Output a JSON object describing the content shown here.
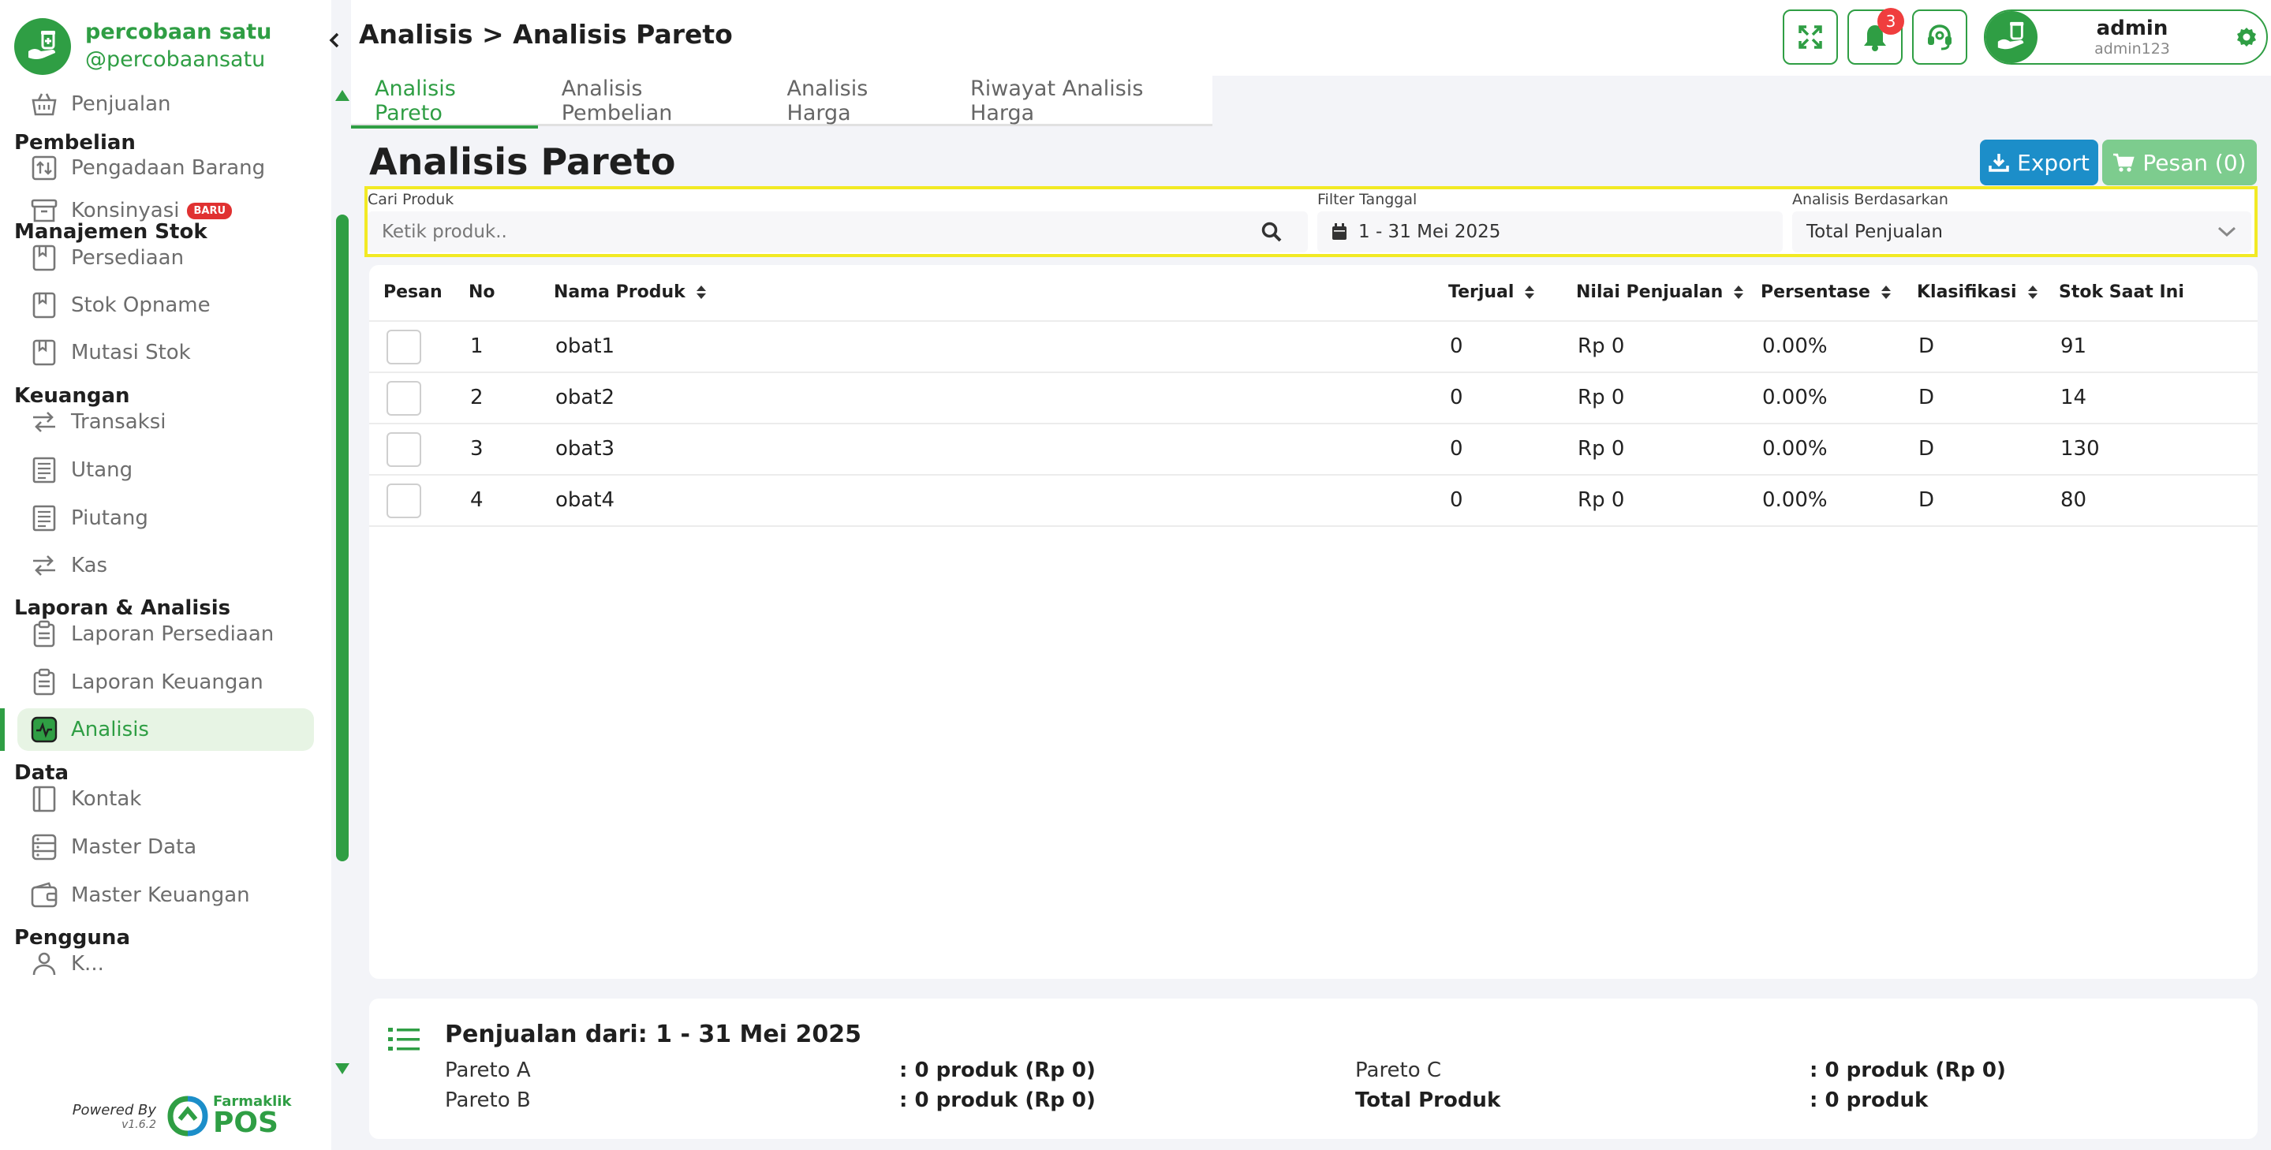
{
  "brand": {
    "name": "percobaan satu",
    "handle": "@percobaansatu"
  },
  "sidebar": {
    "items": [
      {
        "type": "item",
        "label": "Penjualan",
        "icon": "basket-icon"
      },
      {
        "type": "header",
        "label": "Pembelian"
      },
      {
        "type": "item",
        "label": "Pengadaan Barang",
        "icon": "box-transfer-icon"
      },
      {
        "type": "item",
        "label": "Konsinyasi",
        "icon": "archive-icon",
        "badge": "BARU"
      },
      {
        "type": "header",
        "label": "Manajemen Stok"
      },
      {
        "type": "item",
        "label": "Persediaan",
        "icon": "bookmark-icon"
      },
      {
        "type": "item",
        "label": "Stok Opname",
        "icon": "bookmark-icon"
      },
      {
        "type": "item",
        "label": "Mutasi Stok",
        "icon": "bookmark-icon"
      },
      {
        "type": "header",
        "label": "Keuangan"
      },
      {
        "type": "item",
        "label": "Transaksi",
        "icon": "transfer-icon"
      },
      {
        "type": "item",
        "label": "Utang",
        "icon": "receipt-icon"
      },
      {
        "type": "item",
        "label": "Piutang",
        "icon": "receipt-icon"
      },
      {
        "type": "item",
        "label": "Kas",
        "icon": "transfer-icon"
      },
      {
        "type": "header",
        "label": "Laporan & Analisis"
      },
      {
        "type": "item",
        "label": "Laporan Persediaan",
        "icon": "clipboard-icon"
      },
      {
        "type": "item",
        "label": "Laporan Keuangan",
        "icon": "clipboard-icon"
      },
      {
        "type": "item",
        "label": "Analisis",
        "icon": "pulse-icon",
        "active": true
      },
      {
        "type": "header",
        "label": "Data"
      },
      {
        "type": "item",
        "label": "Kontak",
        "icon": "contact-book-icon"
      },
      {
        "type": "item",
        "label": "Master Data",
        "icon": "database-icon"
      },
      {
        "type": "item",
        "label": "Master Keuangan",
        "icon": "wallet-icon"
      },
      {
        "type": "header",
        "label": "Pengguna"
      },
      {
        "type": "item",
        "label": "K...",
        "icon": "user-icon"
      }
    ]
  },
  "powered": {
    "line1": "Powered By",
    "version": "v1.6.2",
    "logo_top": "Farmaklik",
    "logo_bottom": "POS"
  },
  "header": {
    "breadcrumb": "Analisis > Analisis Pareto",
    "notifications": "3",
    "user": {
      "name": "admin",
      "id": "admin123"
    }
  },
  "tabs": [
    {
      "label": "Analisis Pareto",
      "active": true
    },
    {
      "label": "Analisis Pembelian"
    },
    {
      "label": "Analisis Harga"
    },
    {
      "label": "Riwayat Analisis Harga"
    }
  ],
  "main": {
    "title": "Analisis Pareto",
    "export_label": "Export",
    "pesan_label": "Pesan (0)"
  },
  "filters": {
    "search_label": "Cari Produk",
    "search_placeholder": "Ketik produk..",
    "date_label": "Filter Tanggal",
    "date_value": "1 - 31 Mei 2025",
    "basis_label": "Analisis Berdasarkan",
    "basis_value": "Total Penjualan"
  },
  "table": {
    "columns": {
      "pesan": "Pesan",
      "no": "No",
      "nama": "Nama Produk",
      "terjual": "Terjual",
      "nilai": "Nilai Penjualan",
      "persen": "Persentase",
      "klas": "Klasifikasi",
      "stok": "Stok Saat Ini"
    },
    "rows": [
      {
        "no": "1",
        "nama": "obat1",
        "terjual": "0",
        "nilai": "Rp 0",
        "persen": "0.00%",
        "klas": "D",
        "stok": "91"
      },
      {
        "no": "2",
        "nama": "obat2",
        "terjual": "0",
        "nilai": "Rp 0",
        "persen": "0.00%",
        "klas": "D",
        "stok": "14"
      },
      {
        "no": "3",
        "nama": "obat3",
        "terjual": "0",
        "nilai": "Rp 0",
        "persen": "0.00%",
        "klas": "D",
        "stok": "130"
      },
      {
        "no": "4",
        "nama": "obat4",
        "terjual": "0",
        "nilai": "Rp 0",
        "persen": "0.00%",
        "klas": "D",
        "stok": "80"
      }
    ]
  },
  "summary": {
    "title": "Penjualan dari: 1 - 31 Mei 2025",
    "pareto_a_label": "Pareto A",
    "pareto_a_value": ": 0 produk (Rp 0)",
    "pareto_b_label": "Pareto B",
    "pareto_b_value": ": 0 produk (Rp 0)",
    "pareto_c_label": "Pareto C",
    "pareto_c_value": ": 0 produk (Rp 0)",
    "total_label": "Total Produk",
    "total_value": ": 0 produk"
  },
  "colors": {
    "primary": "#2f9e44",
    "export": "#1c8ec9",
    "pesan": "#7dcc8e",
    "highlight": "#f2ea24",
    "badge": "#e03131"
  }
}
